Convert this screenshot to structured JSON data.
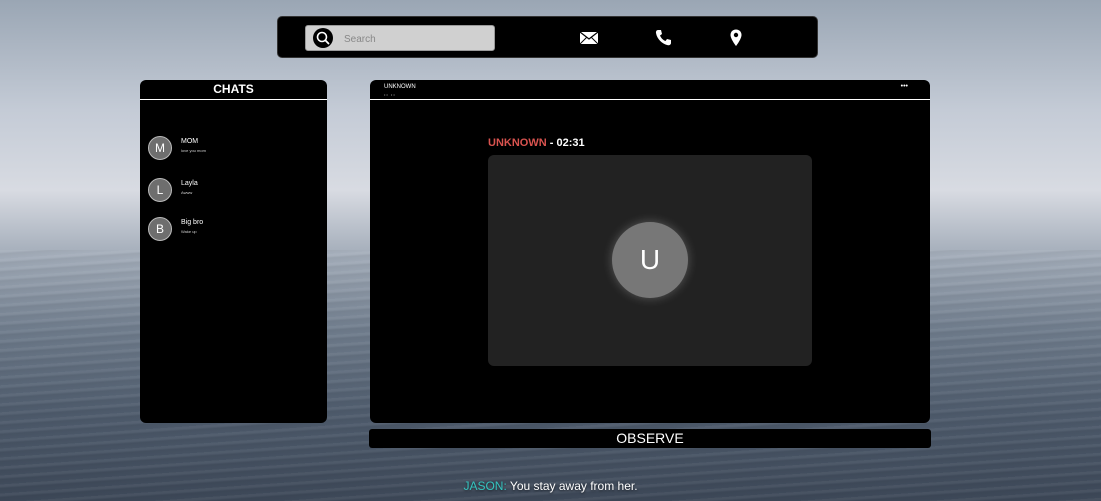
{
  "topbar": {
    "search_placeholder": "Search",
    "icons": [
      "search-icon",
      "mail-icon",
      "phone-icon",
      "location-pin-icon"
    ]
  },
  "chats": {
    "title": "CHATS",
    "items": [
      {
        "initial": "M",
        "name": "MOM",
        "preview": "love you mom"
      },
      {
        "initial": "L",
        "name": "Layla",
        "preview": "Awww"
      },
      {
        "initial": "B",
        "name": "Big bro",
        "preview": "Wake up"
      }
    ]
  },
  "conversation": {
    "contact_name": "UNKNOWN",
    "contact_sub": "•• ••",
    "header_dots": "•••",
    "call": {
      "caller": "UNKNOWN",
      "separator": " - ",
      "timer": "02:31",
      "avatar_initial": "U"
    }
  },
  "observe_button": "OBSERVE",
  "dialogue": {
    "speaker": "JASON:",
    "line": "You stay away from her."
  },
  "colors": {
    "caller_red": "#d9534f",
    "speaker_teal": "#35c5c0"
  }
}
